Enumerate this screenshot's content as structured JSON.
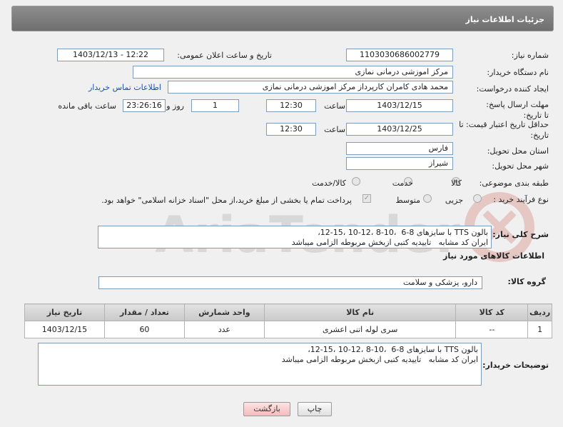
{
  "header": {
    "title": "جزئیات اطلاعات نیاز"
  },
  "form": {
    "need_number_label": "شماره نیاز:",
    "need_number": "1103030686002779",
    "announce_label": "تاریخ و ساعت اعلان عمومی:",
    "announce_value": "1403/12/13 - 12:22",
    "buyer_org_label": "نام دستگاه خریدار:",
    "buyer_org": "مرکز اموزشی درمانی نمازی",
    "creator_label": "ایجاد کننده درخواست:",
    "creator": "محمد هادی کامران کارپرداز مرکز اموزشی درمانی نمازی",
    "contact_link": "اطلاعات تماس خریدار",
    "reply_deadline_label": "مهلت ارسال پاسخ: تا تاریخ:",
    "reply_date": "1403/12/15",
    "time_label": "ساعت",
    "reply_time": "12:30",
    "days_value": "1",
    "days_label": "روز و",
    "remaining_value": "23:26:16",
    "remaining_label": "ساعت باقی مانده",
    "validity_label": "حداقل تاریخ اعتبار قیمت: تا تاریخ:",
    "validity_date": "1403/12/25",
    "validity_time": "12:30",
    "province_label": "استان محل تحویل:",
    "province": "فارس",
    "city_label": "شهر محل تحویل:",
    "city": "شیراز",
    "category_label": "طبقه بندی موضوعی:",
    "category_options": [
      "کالا",
      "خدمت",
      "کالا/خدمت"
    ],
    "process_label": "نوع فرآیند خرید :",
    "process_options": [
      "جزیی",
      "متوسط"
    ],
    "payment_note": "پرداخت تمام یا بخشی از مبلغ خرید،از محل \"اسناد خزانه اسلامی\" خواهد بود."
  },
  "summary": {
    "label": "شرح کلی نیاز:",
    "text": "بالون TTS با سایزهای 8-6  ،10-8 ،12-10 ،15-12،\nایران کد مشابه   تاییدیه کتبی ازبخش مربوطه الزامی میباشد"
  },
  "goods_info": {
    "heading": "اطلاعات کالاهای مورد نیاز",
    "group_label": "گروه کالا:",
    "group_value": "دارو، پزشکی و سلامت"
  },
  "table": {
    "headers": [
      "ردیف",
      "کد کالا",
      "نام کالا",
      "واحد شمارش",
      "تعداد / مقدار",
      "تاریخ نیاز"
    ],
    "rows": [
      [
        "1",
        "--",
        "سری لوله اتنی اعشری",
        "عدد",
        "60",
        "1403/12/15"
      ]
    ]
  },
  "buyer_notes": {
    "label": "توضیحات خریدار:",
    "text": "بالون TTS با سایزهای 8-6  ،10-8 ،12-10 ،15-12،\nایران کد مشابه   تاییدیه کتبی ازبخش مربوطه الزامی میباشد"
  },
  "buttons": {
    "print": "چاپ",
    "back": "بازگشت"
  }
}
